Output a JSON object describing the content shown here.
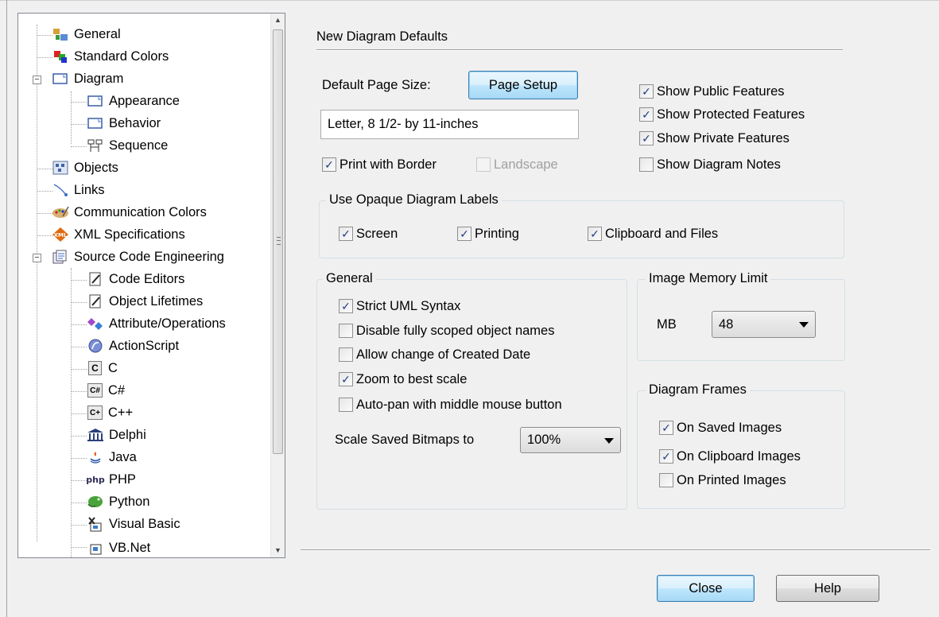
{
  "tree": {
    "items": [
      {
        "label": "General",
        "icon": "general-icon"
      },
      {
        "label": "Standard Colors",
        "icon": "colors-icon"
      },
      {
        "label": "Diagram",
        "icon": "diagram-icon"
      },
      {
        "label": "Appearance",
        "icon": "diagram-page-icon"
      },
      {
        "label": "Behavior",
        "icon": "diagram-page-icon"
      },
      {
        "label": "Sequence",
        "icon": "sequence-icon"
      },
      {
        "label": "Objects",
        "icon": "objects-icon"
      },
      {
        "label": "Links",
        "icon": "links-icon"
      },
      {
        "label": "Communication Colors",
        "icon": "palette-icon"
      },
      {
        "label": "XML Specifications",
        "icon": "xml-icon"
      },
      {
        "label": "Source Code Engineering",
        "icon": "source-code-icon"
      },
      {
        "label": "Code Editors",
        "icon": "pencil-doc-icon"
      },
      {
        "label": "Object Lifetimes",
        "icon": "pencil-doc-icon"
      },
      {
        "label": "Attribute/Operations",
        "icon": "attribute-icon"
      },
      {
        "label": "ActionScript",
        "icon": "actionscript-icon"
      },
      {
        "label": "C",
        "icon": "c-icon"
      },
      {
        "label": "C#",
        "icon": "csharp-icon"
      },
      {
        "label": "C++",
        "icon": "cpp-icon"
      },
      {
        "label": "Delphi",
        "icon": "delphi-icon"
      },
      {
        "label": "Java",
        "icon": "java-icon"
      },
      {
        "label": "PHP",
        "icon": "php-icon"
      },
      {
        "label": "Python",
        "icon": "python-icon"
      },
      {
        "label": "Visual Basic",
        "icon": "vb-icon"
      },
      {
        "label": "VB.Net",
        "icon": "vbnet-icon"
      }
    ],
    "icon_glyphs": {
      "c": "C",
      "csharp": "C#",
      "cpp": "C+",
      "xml": "XML",
      "php": "php"
    }
  },
  "panel": {
    "title": "New Diagram Defaults",
    "page_size_label": "Default Page Size:",
    "page_setup_button": "Page Setup",
    "page_size_value": "Letter, 8 1/2- by 11-inches",
    "print_with_border": {
      "label": "Print with Border",
      "checked": true
    },
    "landscape": {
      "label": "Landscape",
      "checked": false,
      "disabled": true
    },
    "features": [
      {
        "label": "Show Public Features",
        "checked": true
      },
      {
        "label": "Show Protected Features",
        "checked": true
      },
      {
        "label": "Show Private Features",
        "checked": true
      },
      {
        "label": "Show Diagram Notes",
        "checked": false
      }
    ],
    "opaque_labels": {
      "title": "Use Opaque Diagram Labels",
      "options": [
        {
          "label": "Screen",
          "checked": true
        },
        {
          "label": "Printing",
          "checked": true
        },
        {
          "label": "Clipboard and Files",
          "checked": true
        }
      ]
    },
    "general": {
      "title": "General",
      "options": [
        {
          "label": "Strict UML Syntax",
          "checked": true
        },
        {
          "label": "Disable fully scoped object names",
          "checked": false
        },
        {
          "label": "Allow change of Created Date",
          "checked": false
        },
        {
          "label": "Zoom to best scale",
          "checked": true
        },
        {
          "label": "Auto-pan with middle mouse button",
          "checked": false
        }
      ],
      "scale_label": "Scale Saved Bitmaps to",
      "scale_value": "100%"
    },
    "memory": {
      "title": "Image Memory Limit",
      "unit_label": "MB",
      "value": "48"
    },
    "frames": {
      "title": "Diagram Frames",
      "options": [
        {
          "label": "On Saved Images",
          "checked": true
        },
        {
          "label": "On Clipboard Images",
          "checked": true
        },
        {
          "label": "On Printed Images",
          "checked": false
        }
      ]
    }
  },
  "footer": {
    "close_button": "Close",
    "help_button": "Help"
  },
  "colors": {
    "check_mark": "#1f3a83",
    "focus_button": "#3c7fb1"
  }
}
